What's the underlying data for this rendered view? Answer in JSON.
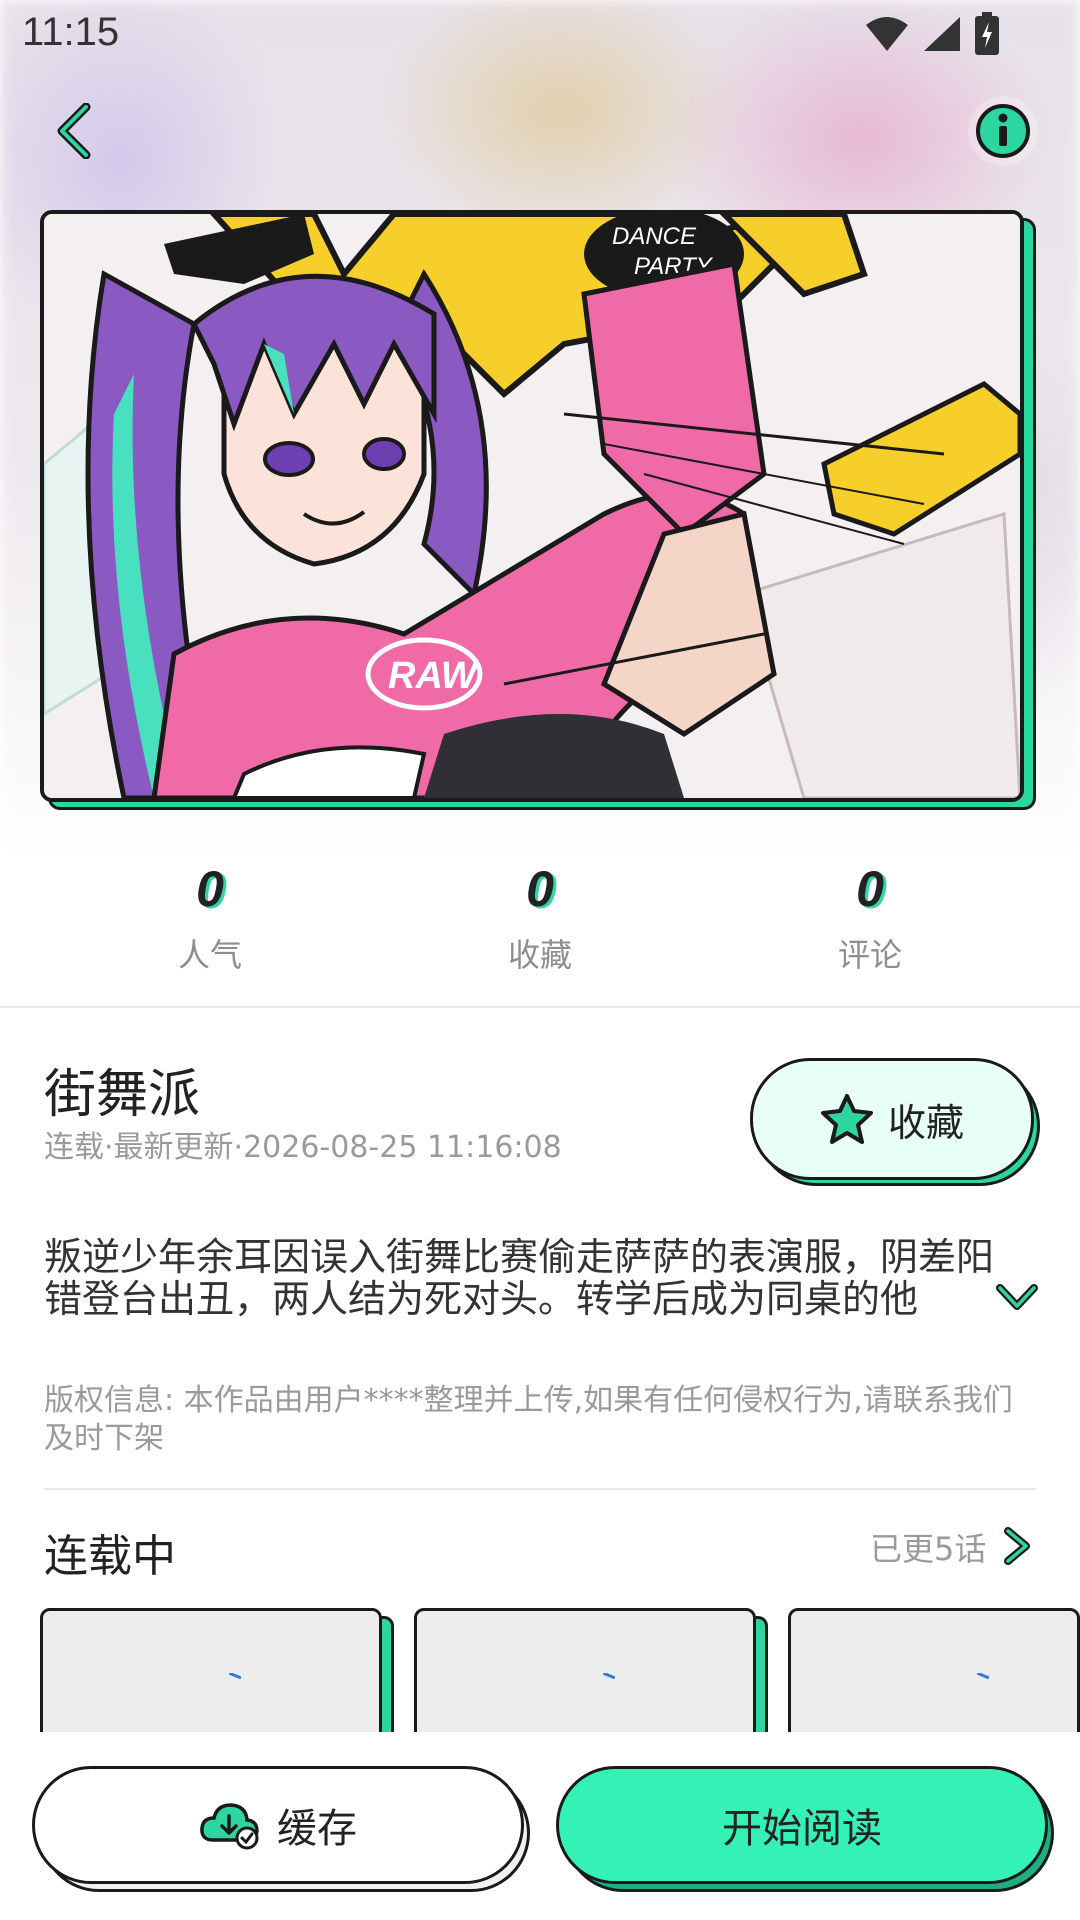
{
  "status_bar": {
    "time": "11:15"
  },
  "comic": {
    "title": "街舞派",
    "meta": "连载·最新更新·2026-08-25 11:16:08",
    "description": "叛逆少年余耳因误入街舞比赛偷走萨萨的表演服，阴差阳错登台出丑，两人结为死对头。转学后成为同桌的他们……",
    "copyright": "版权信息: 本作品由用户****整理并上传,如果有任何侵权行为,请联系我们及时下架",
    "cover_text": {
      "logo": "RAW",
      "badge_line1": "DANCE",
      "badge_line2": "PARTY"
    }
  },
  "stats": [
    {
      "value": "0",
      "label": "人气"
    },
    {
      "value": "0",
      "label": "收藏"
    },
    {
      "value": "0",
      "label": "评论"
    }
  ],
  "favorite_button": {
    "label": "收藏"
  },
  "chapters": {
    "title": "连载中",
    "count_text": "已更5话"
  },
  "bottom": {
    "cache_label": "缓存",
    "read_label": "开始阅读"
  },
  "colors": {
    "accent": "#34f2b6",
    "accent_dark": "#2bd6a0",
    "outline": "#1a1a1a"
  },
  "icons": [
    "back-arrow-icon",
    "info-icon",
    "star-icon",
    "chevron-down-icon",
    "chevron-right-icon",
    "cloud-download-icon",
    "wifi-icon",
    "signal-icon",
    "battery-icon"
  ]
}
